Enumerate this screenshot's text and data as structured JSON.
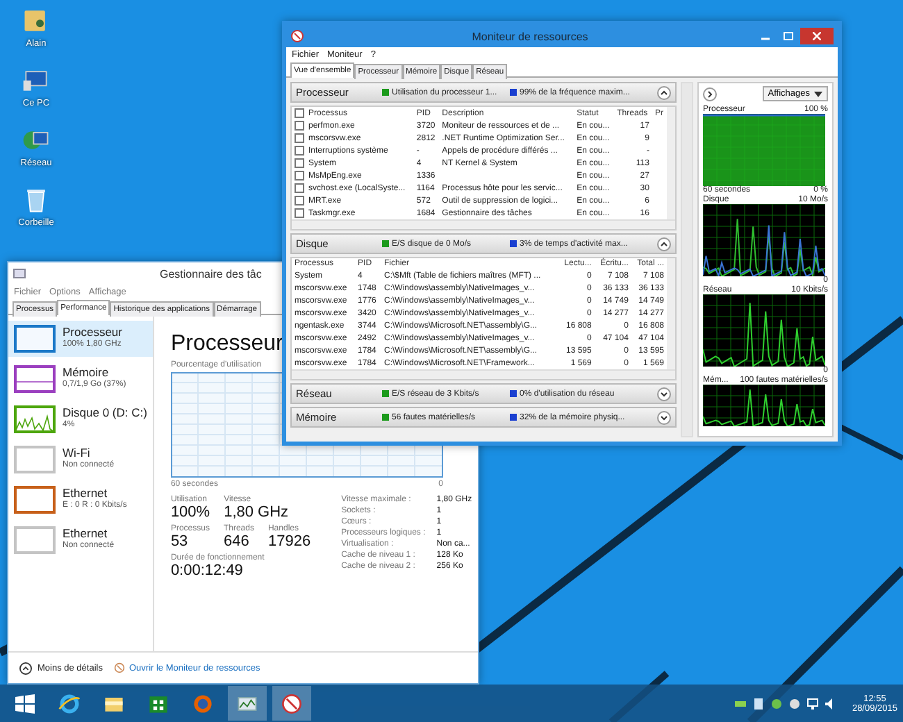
{
  "desktop_icons": [
    {
      "label": "Alain",
      "kind": "user"
    },
    {
      "label": "Ce PC",
      "kind": "pc"
    },
    {
      "label": "Réseau",
      "kind": "network"
    },
    {
      "label": "Corbeille",
      "kind": "bin"
    }
  ],
  "task_manager": {
    "title": "Gestionnaire des tâc",
    "menu": [
      "Fichier",
      "Options",
      "Affichage"
    ],
    "tabs": [
      {
        "label": "Processus",
        "selected": false
      },
      {
        "label": "Performance",
        "selected": true
      },
      {
        "label": "Historique des applications",
        "selected": false
      },
      {
        "label": "Démarrage",
        "selected": false
      }
    ],
    "devices": [
      {
        "name": "Processeur",
        "detail": "100% 1,80 GHz",
        "selected": true,
        "color": "#1a78c8",
        "kind": "blank"
      },
      {
        "name": "Mémoire",
        "detail": "0,7/1,9 Go (37%)",
        "selected": false,
        "color": "#9b3fbf",
        "kind": "line"
      },
      {
        "name": "Disque 0 (D: C:)",
        "detail": "4%",
        "selected": false,
        "color": "#4da60c",
        "kind": "graph"
      },
      {
        "name": "Wi-Fi",
        "detail": "Non connecté",
        "selected": false,
        "color": "#c4c4c4",
        "kind": "blank"
      },
      {
        "name": "Ethernet",
        "detail": "E : 0 R : 0 Kbits/s",
        "selected": false,
        "color": "#c7601a",
        "kind": "blank"
      },
      {
        "name": "Ethernet",
        "detail": "Non connecté",
        "selected": false,
        "color": "#c4c4c4",
        "kind": "blank"
      }
    ],
    "heading": "Processeur",
    "chart_label": "Pourcentage d'utilisation",
    "chart_span": "60 secondes",
    "chart_min": "0",
    "stat_rows": [
      [
        {
          "label": "Utilisation",
          "value": "100%"
        },
        {
          "label": "Vitesse",
          "value": "1,80 GHz"
        }
      ],
      [
        {
          "label": "Processus",
          "value": "53"
        },
        {
          "label": "Threads",
          "value": "646"
        },
        {
          "label": "Handles",
          "value": "17926"
        }
      ],
      [
        {
          "label": "Durée de fonctionnement",
          "value": "0:00:12:49"
        }
      ]
    ],
    "specs": [
      {
        "label": "Vitesse maximale :",
        "value": "1,80 GHz"
      },
      {
        "label": "Sockets :",
        "value": "1"
      },
      {
        "label": "Cœurs :",
        "value": "1"
      },
      {
        "label": "Processeurs logiques :",
        "value": "1"
      },
      {
        "label": "Virtualisation :",
        "value": "Non ca..."
      },
      {
        "label": "Cache de niveau 1 :",
        "value": "128 Ko"
      },
      {
        "label": "Cache de niveau 2 :",
        "value": "256 Ko"
      }
    ],
    "less_details": "Moins de détails",
    "open_monitor": "Ouvrir le Moniteur de ressources"
  },
  "resource_monitor": {
    "title": "Moniteur de ressources",
    "menu": [
      "Fichier",
      "Moniteur",
      "?"
    ],
    "tabs": [
      {
        "label": "Vue d'ensemble",
        "selected": true
      },
      {
        "label": "Processeur",
        "selected": false
      },
      {
        "label": "Mémoire",
        "selected": false
      },
      {
        "label": "Disque",
        "selected": false
      },
      {
        "label": "Réseau",
        "selected": false
      }
    ],
    "sections": [
      {
        "title": "Processeur",
        "expanded": true,
        "checkboxes": true,
        "header_checked": false,
        "stat1": "Utilisation du processeur 1...",
        "stat2": "99% de la fréquence maxim...",
        "columns": [
          "Processus",
          "PID",
          "Description",
          "Statut",
          "Threads",
          "Pr"
        ],
        "rows": [
          {
            "cells": [
              "perfmon.exe",
              "3720",
              "Moniteur de ressources et de ...",
              "En cou...",
              "17"
            ],
            "checked": false
          },
          {
            "cells": [
              "mscorsvw.exe",
              "2812",
              ".NET Runtime Optimization Ser...",
              "En cou...",
              "9"
            ],
            "checked": false
          },
          {
            "cells": [
              "Interruptions système",
              "-",
              "Appels de procédure différés ...",
              "En cou...",
              "-"
            ],
            "checked": false
          },
          {
            "cells": [
              "System",
              "4",
              "NT Kernel & System",
              "En cou...",
              "113"
            ],
            "checked": false
          },
          {
            "cells": [
              "MsMpEng.exe",
              "1336",
              null,
              "En cou...",
              "27"
            ],
            "checked": false
          },
          {
            "cells": [
              "svchost.exe (LocalSyste...",
              "1164",
              "Processus hôte pour les servic...",
              "En cou...",
              "30"
            ],
            "checked": false
          },
          {
            "cells": [
              "MRT.exe",
              "572",
              "Outil de suppression de logici...",
              "En cou...",
              "6"
            ],
            "checked": false
          },
          {
            "cells": [
              "Taskmgr.exe",
              "1684",
              "Gestionnaire des tâches",
              "En cou...",
              "16"
            ],
            "checked": false
          }
        ]
      },
      {
        "title": "Disque",
        "expanded": true,
        "checkboxes": false,
        "stat1": "E/S disque de 0 Mo/s",
        "stat2": "3% de temps d'activité max...",
        "columns": [
          "Processus",
          "PID",
          "Fichier",
          "Lectu...",
          "Écritu...",
          "Total ..."
        ],
        "rows": [
          {
            "cells": [
              "System",
              "4",
              "C:\\$Mft (Table de fichiers maîtres (MFT) ...",
              "0",
              "7 108",
              "7 108"
            ]
          },
          {
            "cells": [
              "mscorsvw.exe",
              "1748",
              "C:\\Windows\\assembly\\NativeImages_v...",
              "0",
              "36 133",
              "36 133"
            ]
          },
          {
            "cells": [
              "mscorsvw.exe",
              "1776",
              "C:\\Windows\\assembly\\NativeImages_v...",
              "0",
              "14 749",
              "14 749"
            ]
          },
          {
            "cells": [
              "mscorsvw.exe",
              "3420",
              "C:\\Windows\\assembly\\NativeImages_v...",
              "0",
              "14 277",
              "14 277"
            ]
          },
          {
            "cells": [
              "ngentask.exe",
              "3744",
              "C:\\Windows\\Microsoft.NET\\assembly\\G...",
              "16 808",
              "0",
              "16 808"
            ]
          },
          {
            "cells": [
              "mscorsvw.exe",
              "2492",
              "C:\\Windows\\assembly\\NativeImages_v...",
              "0",
              "47 104",
              "47 104"
            ]
          },
          {
            "cells": [
              "mscorsvw.exe",
              "1784",
              "C:\\Windows\\Microsoft.NET\\assembly\\G...",
              "13 595",
              "0",
              "13 595"
            ]
          },
          {
            "cells": [
              "mscorsvw.exe",
              "1784",
              "C:\\Windows\\Microsoft.NET\\Framework...",
              "1 569",
              "0",
              "1 569"
            ]
          }
        ]
      },
      {
        "title": "Réseau",
        "expanded": false,
        "stat1": "E/S réseau de 3 Kbits/s",
        "stat2": "0% d'utilisation du réseau"
      },
      {
        "title": "Mémoire",
        "expanded": false,
        "stat1": "56 fautes matérielles/s",
        "stat2": "32% de la mémoire physiq..."
      }
    ],
    "view_button": "Affichages",
    "graphs": [
      {
        "title": "Processeur",
        "max": "100 %",
        "span": "60 secondes",
        "min": "0 %",
        "kind": "full"
      },
      {
        "title": "Disque",
        "max": "10 Mo/s",
        "min": "0",
        "kind": "dual"
      },
      {
        "title": "Réseau",
        "max": "10 Kbits/s",
        "min": "0",
        "kind": "spikes"
      },
      {
        "title": "Mém...",
        "max": "100 fautes matérielles/s",
        "kind": "spikes"
      }
    ]
  },
  "taskbar": {
    "apps": [
      {
        "kind": "ie",
        "active": false
      },
      {
        "kind": "explorer",
        "active": false
      },
      {
        "kind": "store",
        "active": false
      },
      {
        "kind": "firefox",
        "active": false
      },
      {
        "kind": "taskmgr",
        "active": true
      },
      {
        "kind": "resmon",
        "active": true
      }
    ],
    "time": "12:55",
    "date": "28/09/2015"
  }
}
